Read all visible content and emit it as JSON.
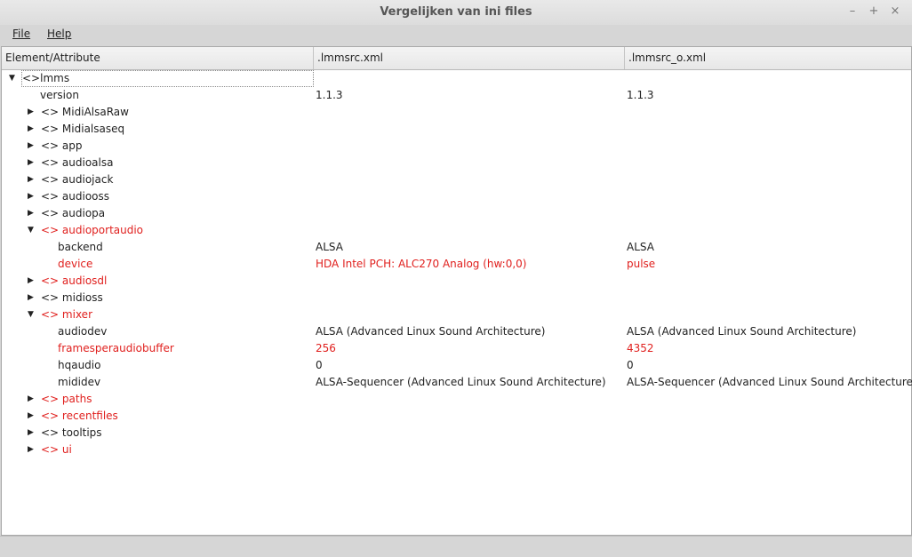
{
  "window": {
    "title": "Vergelijken van ini files",
    "minimize": "–",
    "maximize": "+",
    "close": "×"
  },
  "menu": {
    "file": "File",
    "help": "Help"
  },
  "columns": [
    "Element/Attribute",
    ".lmmsrc.xml",
    ".lmmsrc_o.xml"
  ],
  "rows": [
    {
      "label": "<>lmms",
      "left": "",
      "right": "",
      "expanded": true,
      "toggle": true,
      "diff": false
    },
    {
      "label": "version",
      "left": "1.1.3",
      "right": "1.1.3",
      "toggle": false,
      "diff": false
    },
    {
      "label": "<> MidiAlsaRaw",
      "left": "",
      "right": "",
      "toggle": true,
      "expanded": false,
      "diff": false
    },
    {
      "label": "<> Midialsaseq",
      "left": "",
      "right": "",
      "toggle": true,
      "expanded": false,
      "diff": false
    },
    {
      "label": "<> app",
      "left": "",
      "right": "",
      "toggle": true,
      "expanded": false,
      "diff": false
    },
    {
      "label": "<> audioalsa",
      "left": "",
      "right": "",
      "toggle": true,
      "expanded": false,
      "diff": false
    },
    {
      "label": "<> audiojack",
      "left": "",
      "right": "",
      "toggle": true,
      "expanded": false,
      "diff": false
    },
    {
      "label": "<> audiooss",
      "left": "",
      "right": "",
      "toggle": true,
      "expanded": false,
      "diff": false
    },
    {
      "label": "<> audiopa",
      "left": "",
      "right": "",
      "toggle": true,
      "expanded": false,
      "diff": false
    },
    {
      "label": "<> audioportaudio",
      "left": "",
      "right": "",
      "toggle": true,
      "expanded": true,
      "diff": true
    },
    {
      "label": "backend",
      "left": "ALSA",
      "right": "ALSA",
      "toggle": false,
      "diff": false
    },
    {
      "label": "device",
      "left": "HDA Intel PCH: ALC270 Analog (hw:0,0)",
      "right": "pulse",
      "toggle": false,
      "diff": true
    },
    {
      "label": "<> audiosdl",
      "left": "",
      "right": "",
      "toggle": true,
      "expanded": false,
      "diff": true
    },
    {
      "label": "<> midioss",
      "left": "",
      "right": "",
      "toggle": true,
      "expanded": false,
      "diff": false
    },
    {
      "label": "<> mixer",
      "left": "",
      "right": "",
      "toggle": true,
      "expanded": true,
      "diff": true
    },
    {
      "label": "audiodev",
      "left": "ALSA (Advanced Linux Sound Architecture)",
      "right": "ALSA (Advanced Linux Sound Architecture)",
      "toggle": false,
      "diff": false
    },
    {
      "label": "framesperaudiobuffer",
      "left": "256",
      "right": "4352",
      "toggle": false,
      "diff": true
    },
    {
      "label": "hqaudio",
      "left": "0",
      "right": "0",
      "toggle": false,
      "diff": false
    },
    {
      "label": "mididev",
      "left": "ALSA-Sequencer (Advanced Linux Sound Architecture)",
      "right": "ALSA-Sequencer (Advanced Linux Sound Architecture)",
      "toggle": false,
      "diff": false
    },
    {
      "label": "<> paths",
      "left": "",
      "right": "",
      "toggle": true,
      "expanded": false,
      "diff": true
    },
    {
      "label": "<> recentfiles",
      "left": "",
      "right": "",
      "toggle": true,
      "expanded": false,
      "diff": true
    },
    {
      "label": "<> tooltips",
      "left": "",
      "right": "",
      "toggle": true,
      "expanded": false,
      "diff": false
    },
    {
      "label": "<> ui",
      "left": "",
      "right": "",
      "toggle": true,
      "expanded": false,
      "diff": true
    }
  ],
  "colors": {
    "diff": "#e0201e",
    "text": "#222222"
  }
}
